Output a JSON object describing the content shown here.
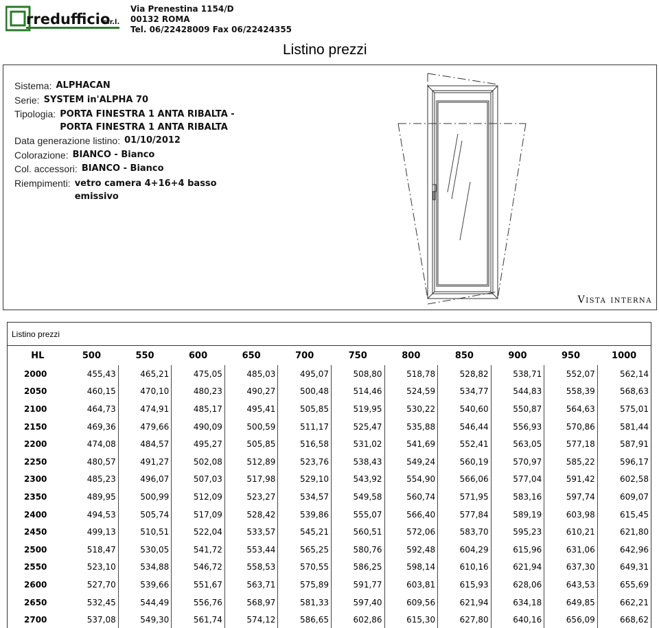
{
  "company": {
    "name": "rredufficio",
    "suffix": "s.r.l.",
    "address_line1": "Via Prenestina 1154/D",
    "address_line2": "00132  ROMA",
    "address_line3": "Tel. 06/22428009  Fax 06/22424355"
  },
  "doc_title": "Listino prezzi",
  "info": {
    "sistema_label": "Sistema:",
    "sistema": "ALPHACAN",
    "serie_label": "Serie:",
    "serie": "SYSTEM in'ALPHA 70",
    "tipologia_label": "Tipologia:",
    "tipologia": "PORTA FINESTRA 1 ANTA RIBALTA - PORTA FINESTRA 1 ANTA RIBALTA",
    "data_label": "Data generazione listino:",
    "data": "01/10/2012",
    "colorazione_label": "Colorazione:",
    "colorazione": "BIANCO - Bianco",
    "col_acc_label": "Col. accessori:",
    "col_acc": "BIANCO - Bianco",
    "riempimenti_label": "Riempimenti:",
    "riempimenti": "vetro camera 4+16+4 basso emissivo"
  },
  "drawing_caption": "Vista interna",
  "price_caption": "Listino prezzi",
  "table": {
    "corner": "HL",
    "widths": [
      "500",
      "550",
      "600",
      "650",
      "700",
      "750",
      "800",
      "850",
      "900",
      "950",
      "1000"
    ],
    "rows": [
      {
        "h": "2000",
        "v": [
          "455,43",
          "465,21",
          "475,05",
          "485,03",
          "495,07",
          "508,80",
          "518,78",
          "528,82",
          "538,71",
          "552,07",
          "562,14"
        ]
      },
      {
        "h": "2050",
        "v": [
          "460,15",
          "470,10",
          "480,23",
          "490,27",
          "500,48",
          "514,46",
          "524,59",
          "534,77",
          "544,83",
          "558,39",
          "568,63"
        ]
      },
      {
        "h": "2100",
        "v": [
          "464,73",
          "474,91",
          "485,17",
          "495,41",
          "505,85",
          "519,95",
          "530,22",
          "540,60",
          "550,87",
          "564,63",
          "575,01"
        ]
      },
      {
        "h": "2150",
        "v": [
          "469,36",
          "479,66",
          "490,09",
          "500,59",
          "511,17",
          "525,47",
          "535,88",
          "546,44",
          "556,93",
          "570,86",
          "581,44"
        ]
      },
      {
        "h": "2200",
        "v": [
          "474,08",
          "484,57",
          "495,27",
          "505,85",
          "516,58",
          "531,02",
          "541,69",
          "552,41",
          "563,05",
          "577,18",
          "587,91"
        ]
      },
      {
        "h": "2250",
        "v": [
          "480,57",
          "491,27",
          "502,08",
          "512,89",
          "523,76",
          "538,43",
          "549,24",
          "560,19",
          "570,97",
          "585,22",
          "596,17"
        ]
      },
      {
        "h": "2300",
        "v": [
          "485,23",
          "496,07",
          "507,03",
          "517,98",
          "529,10",
          "543,92",
          "554,90",
          "566,06",
          "577,04",
          "591,42",
          "602,58"
        ]
      },
      {
        "h": "2350",
        "v": [
          "489,95",
          "500,99",
          "512,09",
          "523,27",
          "534,57",
          "549,58",
          "560,74",
          "571,95",
          "583,16",
          "597,74",
          "609,07"
        ]
      },
      {
        "h": "2400",
        "v": [
          "494,53",
          "505,74",
          "517,09",
          "528,42",
          "539,86",
          "555,07",
          "566,40",
          "577,84",
          "589,19",
          "603,98",
          "615,45"
        ]
      },
      {
        "h": "2450",
        "v": [
          "499,13",
          "510,51",
          "522,04",
          "533,57",
          "545,21",
          "560,51",
          "572,06",
          "583,70",
          "595,23",
          "610,21",
          "621,80"
        ]
      },
      {
        "h": "2500",
        "v": [
          "518,47",
          "530,05",
          "541,72",
          "553,44",
          "565,25",
          "580,76",
          "592,48",
          "604,29",
          "615,96",
          "631,06",
          "642,96"
        ]
      },
      {
        "h": "2550",
        "v": [
          "523,10",
          "534,88",
          "546,72",
          "558,53",
          "570,55",
          "586,25",
          "598,14",
          "610,16",
          "621,94",
          "637,30",
          "649,31"
        ]
      },
      {
        "h": "2600",
        "v": [
          "527,70",
          "539,66",
          "551,67",
          "563,71",
          "575,89",
          "591,77",
          "603,81",
          "615,93",
          "628,06",
          "643,53",
          "655,69"
        ]
      },
      {
        "h": "2650",
        "v": [
          "532,45",
          "544,49",
          "556,76",
          "568,97",
          "581,33",
          "597,40",
          "609,56",
          "621,94",
          "634,18",
          "649,85",
          "662,21"
        ]
      },
      {
        "h": "2700",
        "v": [
          "537,08",
          "549,30",
          "561,74",
          "574,12",
          "586,65",
          "602,86",
          "615,30",
          "627,80",
          "640,16",
          "656,09",
          "668,62"
        ]
      }
    ]
  }
}
